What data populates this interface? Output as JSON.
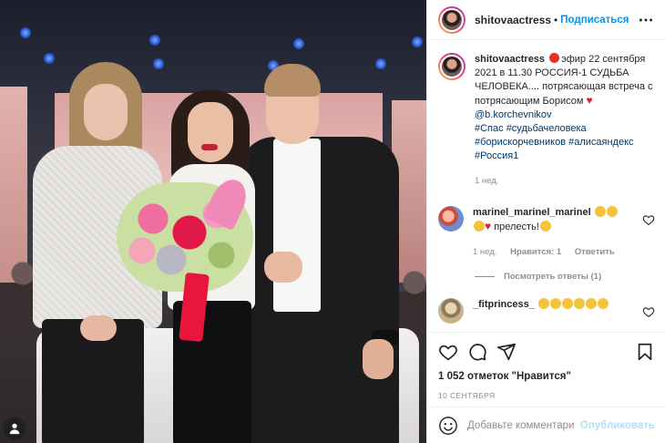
{
  "header": {
    "username": "shitovaactress",
    "separator": "•",
    "follow_label": "Подписаться",
    "more_label": "•••"
  },
  "caption": {
    "username": "shitovaactress",
    "text": "эфир 22 сентября 2021 в 11.30 РОССИЯ-1 СУДЬБА ЧЕЛОВЕКА.... потрясающая встреча с потрясающим Борисом",
    "mention": "@b.korchevnikov",
    "hashtags_line1": "#Спас #судьбачеловека",
    "hashtags_line2": "#борискорчевников #алисаяндекс",
    "hashtags_line3": "#Россия1",
    "time": "1 нед."
  },
  "comments": [
    {
      "username": "marinel_marinel_marinel",
      "text": "прелесть!",
      "time": "1 нед.",
      "likes": "Нравится: 1",
      "reply_label": "Ответить",
      "view_replies": "Посмотреть ответы (1)"
    },
    {
      "username": "_fitprincess_"
    }
  ],
  "actions": {
    "likes_text": "1 052 отметок \"Нравится\"",
    "date": "10 СЕНТЯБРЯ"
  },
  "add_comment": {
    "placeholder": "Добавьте комментарий...",
    "publish_label": "Опубликовать"
  },
  "icons": {
    "like": "heart-icon",
    "comment": "comment-icon",
    "share": "share-icon",
    "save": "bookmark-icon",
    "emoji": "smile-icon",
    "user_tag": "user-icon"
  },
  "colors": {
    "accent": "#0095f6",
    "link": "#00376b",
    "muted": "#8e8e8e",
    "publish_disabled": "#b2dffc"
  }
}
